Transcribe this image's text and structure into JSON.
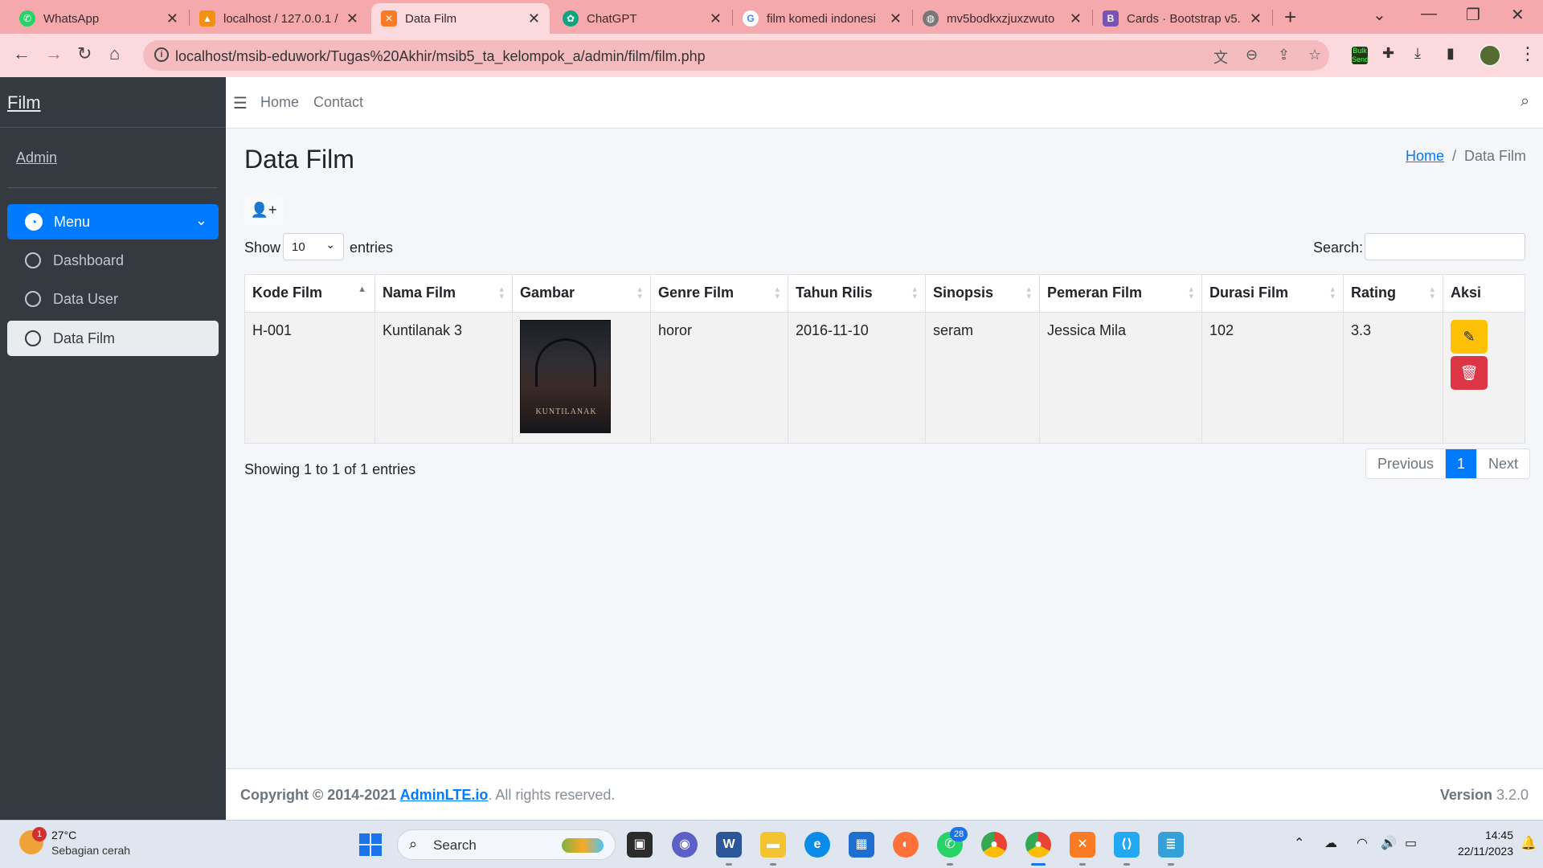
{
  "browser": {
    "tabs": [
      {
        "label": "WhatsApp",
        "color": "#25d366",
        "icon": "whatsapp-icon",
        "active": false
      },
      {
        "label": "localhost / 127.0.0.1 /",
        "color": "#f29111",
        "icon": "phpmyadmin-icon",
        "active": false
      },
      {
        "label": "Data Film",
        "color": "#fb7a24",
        "icon": "xampp-icon",
        "active": true
      },
      {
        "label": "ChatGPT",
        "color": "#10a37f",
        "icon": "chatgpt-icon",
        "active": false
      },
      {
        "label": "film komedi indonesi",
        "color": "#4285f4",
        "icon": "google-icon",
        "active": false
      },
      {
        "label": "mv5bodkxzjuxzwuto",
        "color": "#777777",
        "icon": "globe-icon",
        "active": false
      },
      {
        "label": "Cards · Bootstrap v5.",
        "color": "#7952b3",
        "icon": "bootstrap-icon",
        "active": false
      }
    ],
    "url": "localhost/msib-eduwork/Tugas%20Akhir/msib5_ta_kelompok_a/admin/film/film.php",
    "ext_label": "Bulk Send"
  },
  "sidebar": {
    "brand": "Film",
    "user": "Admin",
    "menu_label": "Menu",
    "items": [
      {
        "label": "Dashboard",
        "active": false
      },
      {
        "label": "Data User",
        "active": false
      },
      {
        "label": "Data Film",
        "active": true
      }
    ]
  },
  "topnav": {
    "links": [
      "Home",
      "Contact"
    ]
  },
  "content": {
    "title": "Data Film",
    "breadcrumb": {
      "home": "Home",
      "current": "Data Film"
    },
    "show_label": "Show",
    "length_value": "10",
    "entries_label": "entries",
    "search_label": "Search:",
    "columns": [
      "Kode Film",
      "Nama Film",
      "Gambar",
      "Genre Film",
      "Tahun Rilis",
      "Sinopsis",
      "Pemeran Film",
      "Durasi Film",
      "Rating",
      "Aksi"
    ],
    "rows": [
      {
        "kode": "H-001",
        "nama": "Kuntilanak 3",
        "poster_text": "KUNTILANAK",
        "genre": "horor",
        "tahun": "2016-11-10",
        "sinopsis": "seram",
        "pemeran": "Jessica Mila",
        "durasi": "102",
        "rating": "3.3"
      }
    ],
    "info": "Showing 1 to 1 of 1 entries",
    "pager": {
      "prev": "Previous",
      "page": "1",
      "next": "Next"
    }
  },
  "footer": {
    "copyright_prefix": "Copyright © 2014-2021 ",
    "copyright_link": "AdminLTE.io",
    "copyright_suffix": ". All rights reserved.",
    "version_label": "Version",
    "version_value": "3.2.0"
  },
  "taskbar": {
    "weather_temp": "27°C",
    "weather_desc": "Sebagian cerah",
    "weather_badge": "1",
    "search_label": "Search",
    "whatsapp_badge": "28",
    "time": "14:45",
    "date": "22/11/2023"
  },
  "colors": {
    "primary": "#007bff",
    "sidebar_bg": "#343a40",
    "warning": "#ffc107",
    "danger": "#dc3545",
    "browser_tab_bg": "#f6a9ad"
  }
}
